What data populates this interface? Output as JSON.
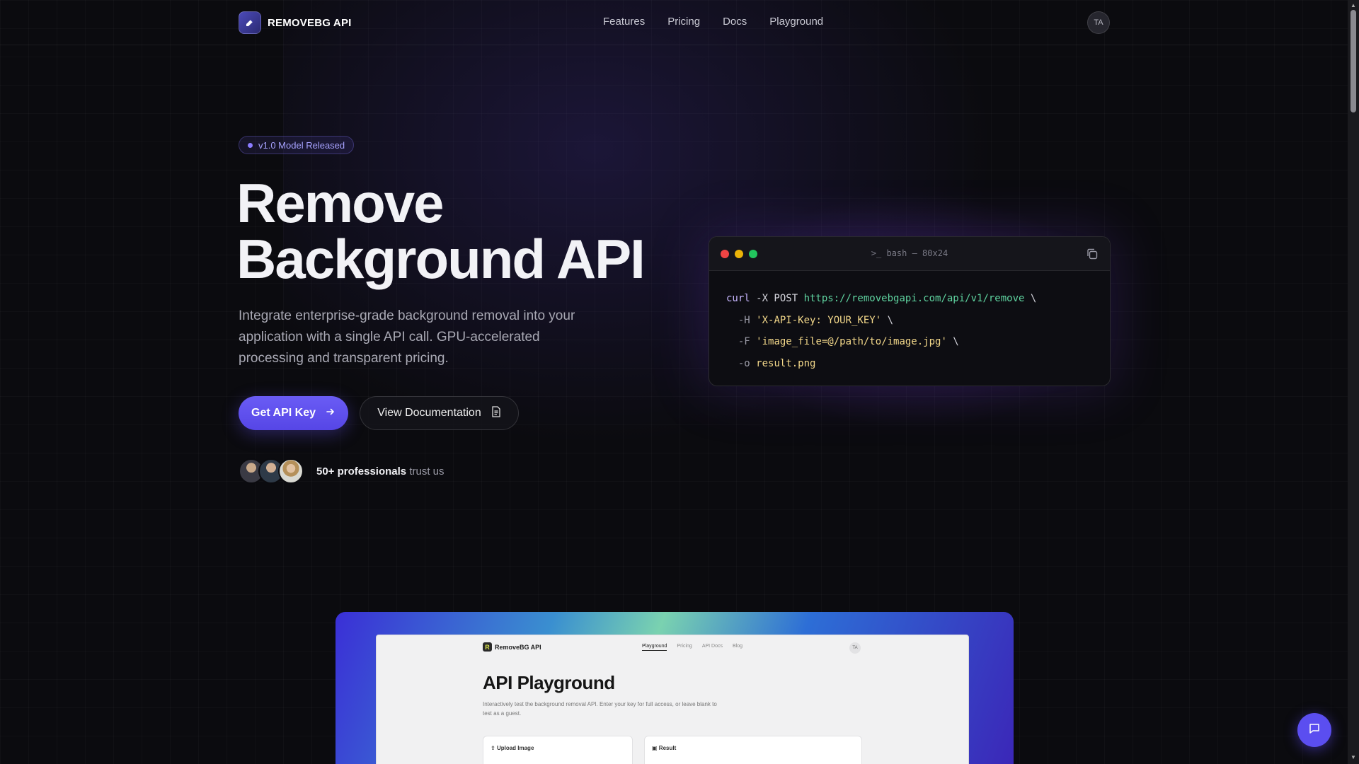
{
  "nav": {
    "brand": "REMOVEBG API",
    "links": [
      "Features",
      "Pricing",
      "Docs",
      "Playground"
    ],
    "avatar_initials": "TA"
  },
  "hero": {
    "badge": "v1.0 Model Released",
    "title_line1": "Remove",
    "title_line2": "Background API",
    "subtitle": "Integrate enterprise-grade background removal into your application with a single API call. GPU-accelerated processing and transparent pricing.",
    "primary_button": "Get API Key",
    "secondary_button": "View Documentation",
    "trust_bold": "50+ professionals",
    "trust_rest": "trust us"
  },
  "terminal": {
    "title": "bash — 80x24",
    "line1": {
      "cmd": "curl",
      "rest": " -X POST ",
      "url": "https://removebgapi.com/api/v1/remove",
      "tail": " \\"
    },
    "line2": {
      "flag": "  -H ",
      "str": "'X-API-Key: YOUR_KEY'",
      "tail": " \\"
    },
    "line3": {
      "flag": "  -F ",
      "str": "'image_file=@/path/to/image.jpg'",
      "tail": " \\"
    },
    "line4": {
      "flag": "  -o ",
      "str": "result.png"
    }
  },
  "preview": {
    "logo_letter": "R",
    "brand": "RemoveBG API",
    "links": [
      "Playground",
      "Pricing",
      "API Docs",
      "Blog"
    ],
    "avatar": "TA",
    "title": "API Playground",
    "desc": "Interactively test the background removal API. Enter your key for full access, or leave blank to test as a guest.",
    "upload_label": "Upload Image",
    "result_label": "Result"
  },
  "colors": {
    "accent": "#5b4ef0",
    "background": "#0b0b0f",
    "dot_red": "#ef4444",
    "dot_yellow": "#eab308",
    "dot_green": "#22c55e"
  }
}
